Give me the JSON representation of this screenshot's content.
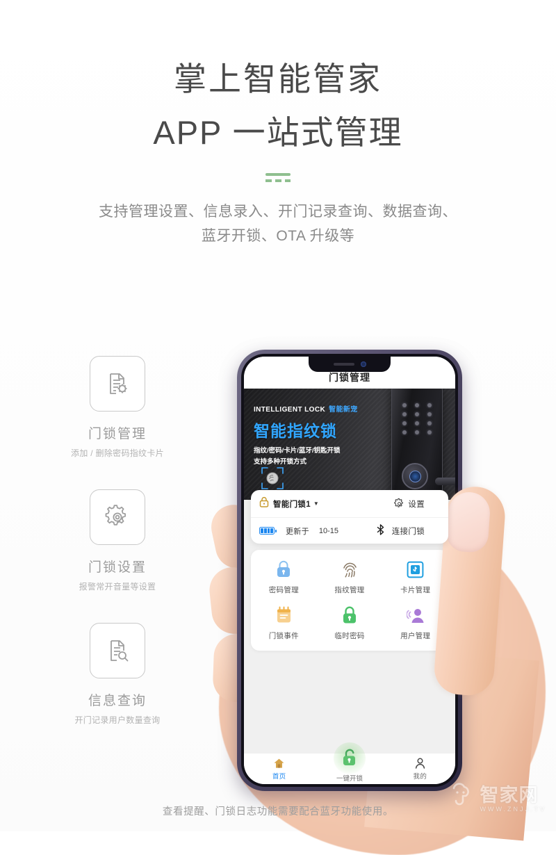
{
  "hero": {
    "title_line1": "掌上智能管家",
    "title_line2": "APP 一站式管理",
    "subtitle_line1": "支持管理设置、信息录入、开门记录查询、数据查询、",
    "subtitle_line2": "蓝牙开锁、OTA 升级等",
    "accent_color": "#8fbf8f"
  },
  "features": [
    {
      "icon": "document-gear-icon",
      "title": "门锁管理",
      "desc": "添加 / 删除密码指纹卡片"
    },
    {
      "icon": "gear-icon",
      "title": "门锁设置",
      "desc": "报警常开音量等设置"
    },
    {
      "icon": "document-search-icon",
      "title": "信息查询",
      "desc": "开门记录用户数量查询"
    }
  ],
  "phone": {
    "titlebar": "门锁管理",
    "banner": {
      "eyebrow_en": "INTELLIGENT LOCK",
      "eyebrow_cn": "智能新宠",
      "headline": "智能指纹锁",
      "line1": "指纹/密码/卡片/蓝牙/钥匙开锁",
      "line2": "支持多种开锁方式",
      "headline_color": "#31a6ff"
    },
    "device_card": {
      "lock_icon": "lock-icon",
      "device_name": "智能门锁1",
      "caret": "▼",
      "settings_icon": "gear-icon",
      "settings_label": "设置",
      "battery_icon": "battery-icon",
      "updated_label": "更新于",
      "updated_date": "10-15",
      "bluetooth_icon": "bluetooth-icon",
      "connect_label": "连接门锁"
    },
    "functions": [
      {
        "icon": "password-lock-icon",
        "label": "密码管理",
        "color": "#7ab6ee"
      },
      {
        "icon": "fingerprint-icon",
        "label": "指纹管理",
        "color": "#8a7a66"
      },
      {
        "icon": "card-icon",
        "label": "卡片管理",
        "color": "#1f9fe0"
      },
      {
        "icon": "calendar-event-icon",
        "label": "门锁事件",
        "color": "#f0b24a"
      },
      {
        "icon": "temp-password-lock-icon",
        "label": "临时密码",
        "color": "#4cc26a"
      },
      {
        "icon": "user-manage-icon",
        "label": "用户管理",
        "color": "#a97ad6"
      }
    ],
    "nav": {
      "home_icon": "home-icon",
      "home_label": "首页",
      "unlock_icon": "unlock-icon",
      "unlock_label": "一键开锁",
      "profile_icon": "person-icon",
      "profile_label": "我的",
      "active_color": "#1a86f0",
      "unlock_color": "#4cc26a"
    }
  },
  "footer": {
    "note": "查看提醒、门锁日志功能需要配合蓝牙功能使用。"
  },
  "watermark": {
    "icon": "cloud-face-icon",
    "name": "智家网",
    "url": "WWW.ZNJJ.TV"
  }
}
